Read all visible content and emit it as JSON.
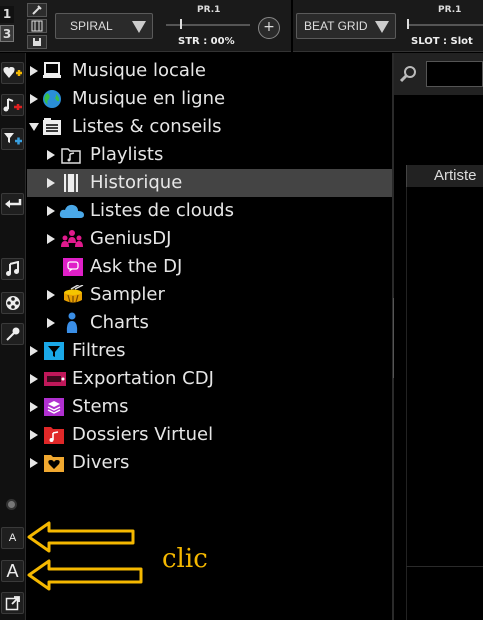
{
  "toolbar": {
    "deck_left": "1",
    "deck_active": "3",
    "fx_combo": "SPIRAL",
    "fx_slider_label": "PR.1",
    "fx_slider_value": "STR :  00%",
    "sampler_combo": "BEAT GRID",
    "sampler_slider_label": "PR.1",
    "sampler_slider_value": "SLOT : Slot",
    "plus": "+"
  },
  "left_strip": {
    "font_small": "A",
    "font_large": "A"
  },
  "tree": [
    {
      "label": "Musique locale",
      "icon": "computer-icon",
      "expanded": false,
      "level": 0
    },
    {
      "label": "Musique en ligne",
      "icon": "globe-icon",
      "expanded": false,
      "level": 0
    },
    {
      "label": "Listes & conseils",
      "icon": "list-folder-icon",
      "expanded": true,
      "level": 0
    },
    {
      "label": "Playlists",
      "icon": "playlist-folder-icon",
      "expanded": false,
      "level": 1
    },
    {
      "label": "Historique",
      "icon": "history-icon",
      "expanded": false,
      "level": 1,
      "selected": true
    },
    {
      "label": "Listes de clouds",
      "icon": "cloud-icon",
      "expanded": false,
      "level": 1
    },
    {
      "label": "GeniusDJ",
      "icon": "people-icon",
      "expanded": false,
      "level": 1
    },
    {
      "label": "Ask the DJ",
      "icon": "chat-icon",
      "expanded": null,
      "level": 1
    },
    {
      "label": "Sampler",
      "icon": "drum-icon",
      "expanded": false,
      "level": 1
    },
    {
      "label": "Charts",
      "icon": "person-chart-icon",
      "expanded": false,
      "level": 1
    },
    {
      "label": "Filtres",
      "icon": "filter-icon",
      "expanded": false,
      "level": 0
    },
    {
      "label": "Exportation CDJ",
      "icon": "cdj-icon",
      "expanded": false,
      "level": 0
    },
    {
      "label": "Stems",
      "icon": "stems-icon",
      "expanded": false,
      "level": 0
    },
    {
      "label": "Dossiers Virtuel",
      "icon": "virtual-folder-icon",
      "expanded": false,
      "level": 0
    },
    {
      "label": "Divers",
      "icon": "heart-folder-icon",
      "expanded": false,
      "level": 0
    }
  ],
  "folders_tab": "folders",
  "right_panel": {
    "search_value": "",
    "column_header": "Artiste"
  },
  "annotation": {
    "text": "clic",
    "color": "#f5b800"
  },
  "colors": {
    "selected_row": "#444444",
    "arrow": "#f5b800"
  }
}
